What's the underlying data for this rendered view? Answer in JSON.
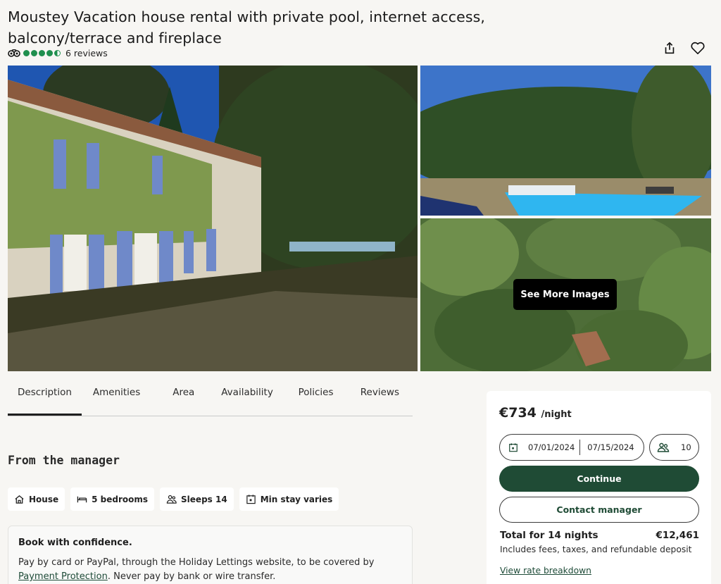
{
  "listing": {
    "title": "Moustey Vacation house rental with private pool, internet access, balcony/terrace and fireplace",
    "reviews_text": "6 reviews",
    "rating_bubbles": 4.5
  },
  "header_icons": [
    "share-icon",
    "heart-icon"
  ],
  "gallery": {
    "see_more_label": "See More Images"
  },
  "tabs": [
    {
      "label": "Description"
    },
    {
      "label": "Amenities"
    },
    {
      "label": "Area"
    },
    {
      "label": "Availability"
    },
    {
      "label": "Policies"
    },
    {
      "label": "Reviews"
    }
  ],
  "section": {
    "title": "From the manager"
  },
  "chips": [
    {
      "label": "House",
      "icon": "house-icon"
    },
    {
      "label": "5 bedrooms",
      "icon": "bed-icon"
    },
    {
      "label": "Sleeps 14",
      "icon": "people-icon"
    },
    {
      "label": "Min stay varies",
      "icon": "calendar-icon"
    }
  ],
  "confidence": {
    "heading": "Book with confidence.",
    "text_before": "Pay by card or PayPal, through the Holiday Lettings website, to be covered by ",
    "link": "Payment Protection",
    "text_after": ". Never pay by bank or wire transfer."
  },
  "booking": {
    "price": "€734",
    "per_night": "/night",
    "check_in": "07/01/2024",
    "check_out": "07/15/2024",
    "guests": "10",
    "continue_label": "Continue",
    "contact_label": "Contact manager",
    "total_label": "Total for 14 nights",
    "total_value": "€12,461",
    "total_sub": "Includes fees, taxes, and refundable deposit",
    "rate_link": "View rate breakdown"
  },
  "colors": {
    "brand_green": "#1f4b35",
    "rating_green": "#1f8f4e",
    "background": "#f7f6f3"
  }
}
